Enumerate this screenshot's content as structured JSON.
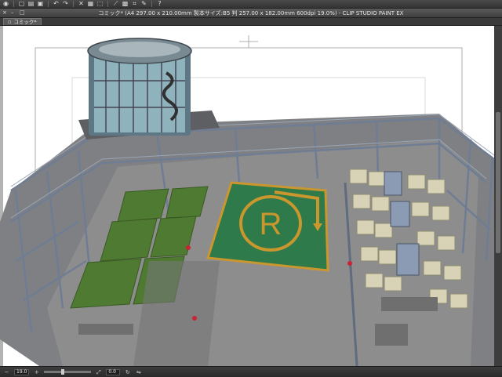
{
  "app": {
    "title": "コミック* (A4 297.00 x 210.00mm 製本サイズ:B5 判 257.00 x 182.00mm 600dpi 19.0%) - CLIP STUDIO PAINT EX"
  },
  "toolbar": {
    "icons": [
      "eye-icon",
      "new-icon",
      "open-icon",
      "save-icon",
      "undo-icon",
      "redo-icon",
      "clear-icon",
      "fill-icon",
      "transform-icon",
      "ruler-icon",
      "grid-icon",
      "snap-icon",
      "pen-icon",
      "help-icon"
    ]
  },
  "tab": {
    "label": "コミック*"
  },
  "canvas": {
    "scene": "3D rooftop heliport with water tank, steel scaffolding, grass planters and air-conditioning units",
    "helipad_letter": "R",
    "colors": {
      "helipad": "#2e7a4a",
      "helipad_border": "#c9972e",
      "concrete": "#8e8e8e",
      "steel": "#7b8aa0",
      "grass": "#4f7a32"
    }
  },
  "status": {
    "zoom": "19.0",
    "angle": "0.0"
  }
}
